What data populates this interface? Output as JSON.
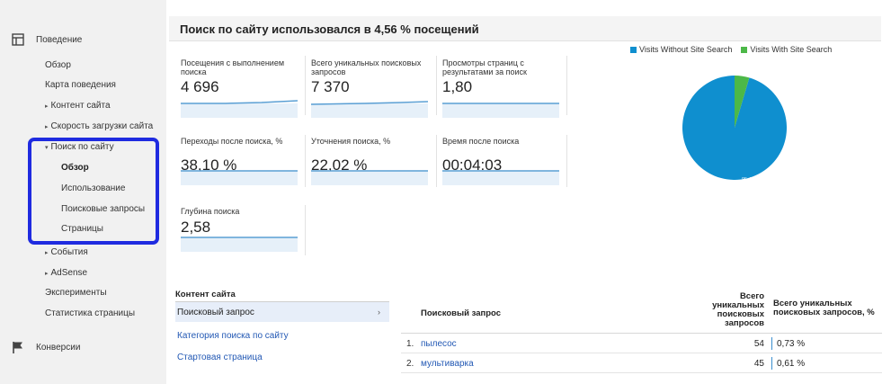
{
  "sidebar": {
    "behavior_section": "Поведение",
    "conversions_section": "Конверсии",
    "items": {
      "overview": "Обзор",
      "behavior_flow": "Карта поведения",
      "site_content": "Контент сайта",
      "site_speed": "Скорость загрузки сайта",
      "site_search": "Поиск по сайту",
      "ss_overview": "Обзор",
      "ss_usage": "Использование",
      "ss_terms": "Поисковые запросы",
      "ss_pages": "Страницы",
      "events": "События",
      "adsense": "AdSense",
      "experiments": "Эксперименты",
      "page_stats": "Статистика страницы"
    }
  },
  "header": {
    "title": "Поиск по сайту использовался в 4,56 % посещений"
  },
  "metrics": [
    {
      "label": "Посещения с выполнением поиска",
      "value": "4 696"
    },
    {
      "label": "Всего уникальных поисковых запросов",
      "value": "7 370"
    },
    {
      "label": "Просмотры страниц с результатами за поиск",
      "value": "1,80"
    },
    {
      "label": "Переходы после поиска, %",
      "value": "38,10 %"
    },
    {
      "label": "Уточнения поиска, %",
      "value": "22,02 %"
    },
    {
      "label": "Время после поиска",
      "value": "00:04:03"
    },
    {
      "label": "Глубина поиска",
      "value": "2,58"
    }
  ],
  "pie": {
    "legend": [
      "Visits Without Site Search",
      "Visits With Site Search"
    ],
    "slice_label": "95.4%",
    "values": [
      95.44,
      4.56
    ],
    "colors": [
      "#0f8fcf",
      "#4cb848"
    ]
  },
  "content_panel": {
    "title": "Контент сайта",
    "selected": "Поисковый запрос",
    "links": [
      "Категория поиска по сайту",
      "Стартовая страница"
    ]
  },
  "query_table": {
    "col_query": "Поисковый запрос",
    "col_total": "Всего уникальных поисковых запросов",
    "col_pct": "Всего уникальных поисковых запросов, %",
    "rows": [
      {
        "num": "1.",
        "query": "пылесос",
        "value": "54",
        "pct": "0,73 %"
      },
      {
        "num": "2.",
        "query": "мультиварка",
        "value": "45",
        "pct": "0,61 %"
      }
    ]
  }
}
